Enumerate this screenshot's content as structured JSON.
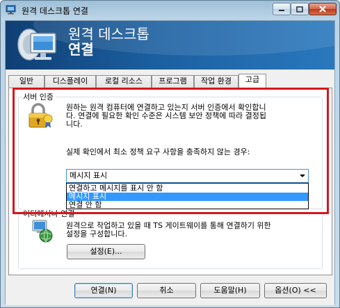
{
  "window": {
    "title": "원격 데스크톱 연결",
    "icon": "remote-desktop-icon"
  },
  "banner": {
    "title": "원격 데스크톱",
    "subtitle": "연결",
    "logo": "monitor-satellite-logo"
  },
  "tabs": [
    {
      "label": "일반",
      "active": false
    },
    {
      "label": "디스플레이",
      "active": false
    },
    {
      "label": "로컬 리소스",
      "active": false
    },
    {
      "label": "프로그램",
      "active": false
    },
    {
      "label": "작업 환경",
      "active": false
    },
    {
      "label": "고급",
      "active": true
    }
  ],
  "server_auth": {
    "group_label": "서버 인증",
    "icon": "lock-certificate-icon",
    "description_lines": [
      "원하는 원격 컴퓨터에 연결하고 있는지 서버 인증에서 확인합니",
      "다. 연결에 필요한 확인 수준은 시스템 보안 정책에 따라 결정됩",
      "니다."
    ],
    "prompt": "실제 확인에서 최소 정책 요구 사항을 충족하지 않는 경우:",
    "combo_value": "메시지 표시",
    "options": [
      "연결하고 메시지를 표시 안 함",
      "메시지 표시",
      "연결 안 함"
    ],
    "selected_index": 1
  },
  "connect_anywhere": {
    "group_label": "어디에서나 연결",
    "icon": "network-globe-icon",
    "description_lines": [
      "원격으로 작업하고 있을 때 TS 게이트웨이를 통해 연결하기 위한",
      "설정을 구성합니다."
    ],
    "settings_button": "설정(E)..."
  },
  "footer": {
    "connect": "연결(N)",
    "cancel": "취소",
    "help": "도움말(H)",
    "options": "옵션(O) <<"
  },
  "colors": {
    "highlight_border": "#d8141b",
    "selection": "#3399ff",
    "banner": "#1b5fa0"
  }
}
